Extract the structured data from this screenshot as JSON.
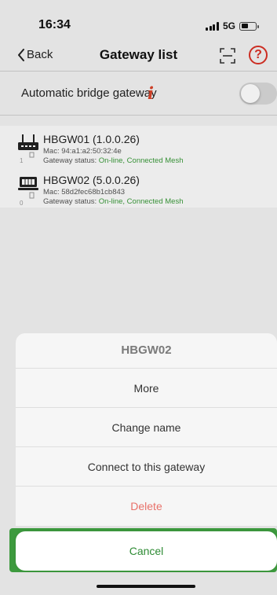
{
  "status_bar": {
    "time": "16:34",
    "network": "5G"
  },
  "nav": {
    "back_label": "Back",
    "title": "Gateway list",
    "help_label": "?"
  },
  "auto_bridge": {
    "label": "Automatic bridge gateway",
    "info_label": "i",
    "enabled": false
  },
  "gateways": [
    {
      "index": "1",
      "name": "HBGW01 (1.0.0.26)",
      "mac": "Mac: 94:a1:a2:50:32:4e",
      "status_prefix": "Gateway status: ",
      "status_value": "On-line, Connected Mesh"
    },
    {
      "index": "0",
      "name": "HBGW02 (5.0.0.26)",
      "mac": "Mac: 58d2fec68b1cb843",
      "status_prefix": "Gateway status: ",
      "status_value": "On-line, Connected Mesh"
    }
  ],
  "action_sheet": {
    "title": "HBGW02",
    "items": [
      "More",
      "Change name",
      "Connect to this gateway",
      "Delete"
    ],
    "cancel_label": "Cancel"
  },
  "colors": {
    "accent_red": "#d93025",
    "online_green": "#3a9a3a",
    "delete_red": "#e8716a",
    "cancel_green": "#2e8b34"
  }
}
